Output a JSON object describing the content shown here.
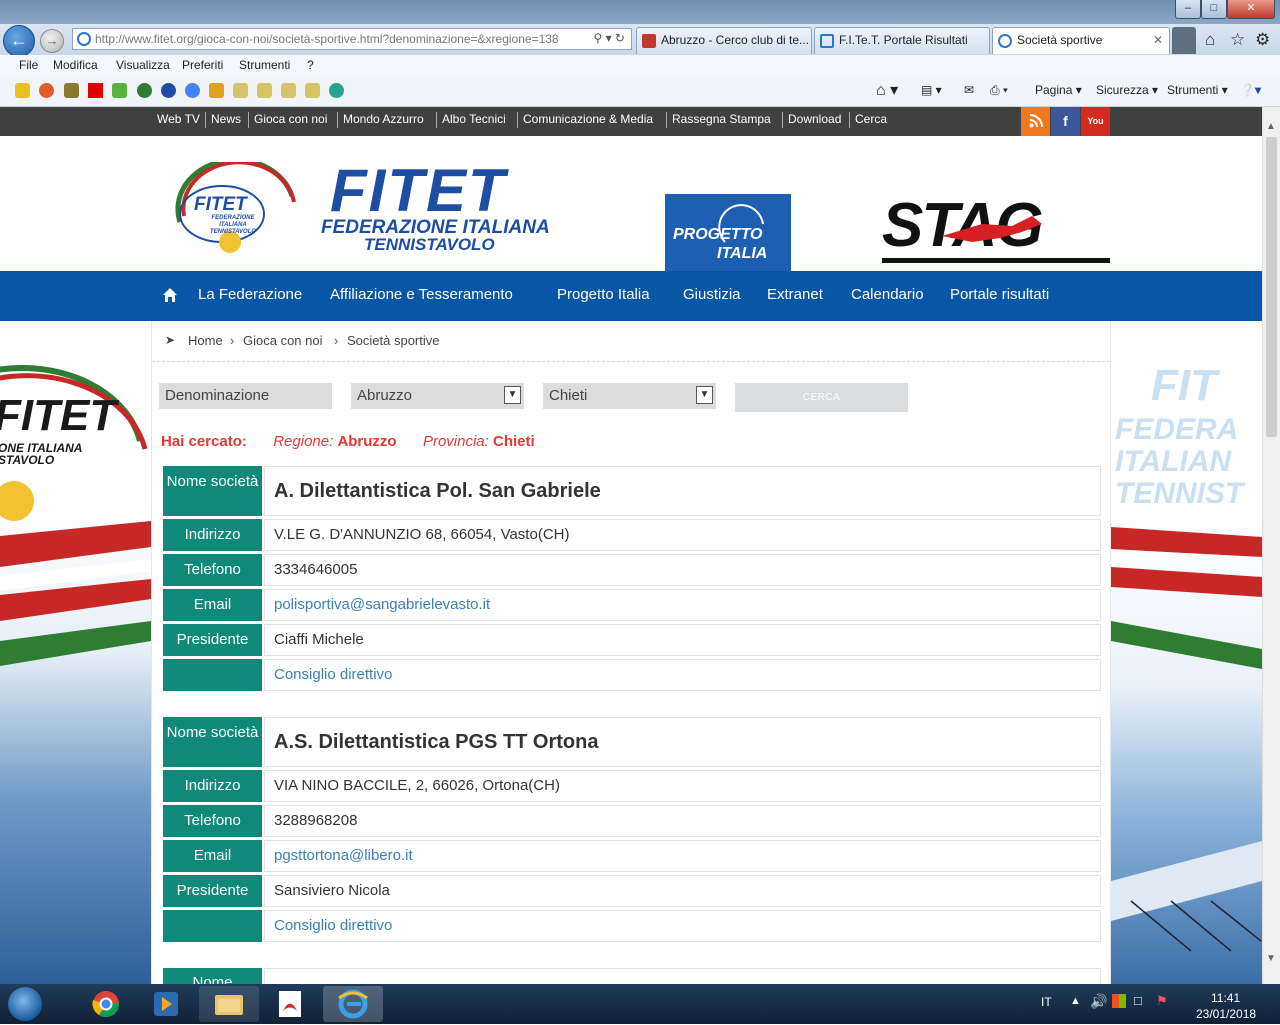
{
  "browser": {
    "url": "http://www.fitet.org/gioca-con-noi/società-sportive.html?denominazione=&xregione=138",
    "tabs": [
      {
        "label": "Abruzzo - Cerco club di te..."
      },
      {
        "label": "F.I.Te.T. Portale Risultati"
      },
      {
        "label": "Società sportive"
      }
    ],
    "menu": [
      "File",
      "Modifica",
      "Visualizza",
      "Preferiti",
      "Strumenti",
      "?"
    ],
    "toolbar": {
      "pagina": "Pagina",
      "sicurezza": "Sicurezza",
      "strumenti": "Strumenti"
    }
  },
  "site": {
    "toplinks": [
      "Web TV",
      "News",
      "Gioca con noi",
      "Mondo Azzurro",
      "Albo Tecnici",
      "Comunicazione & Media",
      "Rassegna Stampa",
      "Download",
      "Cerca"
    ],
    "social": {
      "rss": "",
      "facebook": "f",
      "youtube": "You"
    },
    "logo": {
      "round_text": "FITET",
      "round_sub": "FEDERAZIONE ITALIANA TENNISTAVOLO",
      "word": "FITET",
      "sub1": "FEDERAZIONE ITALIANA",
      "sub2": "TENNISTAVOLO"
    },
    "progetto": {
      "line1": "PROGETTO",
      "line2": "ITALIA"
    },
    "stag": "STAG",
    "mainnav": [
      "La Federazione",
      "Affiliazione e Tesseramento",
      "Progetto Italia",
      "Giustizia",
      "Extranet",
      "Calendario",
      "Portale risultati"
    ],
    "side_text": {
      "left1": "FITET",
      "left2": "ONE ITALIANA",
      "left3": "STAVOLO",
      "right1": "FIT",
      "right2": "FEDERA",
      "right3": "ITALIAN",
      "right4": "TENNIST"
    }
  },
  "breadcrumb": [
    "Home",
    "Gioca con noi",
    "Società sportive"
  ],
  "filters": {
    "denominazione": "Denominazione",
    "regione": "Abruzzo",
    "provincia": "Chieti",
    "search_label": "CERCA"
  },
  "searched": {
    "label": "Hai cercato:",
    "regione_label": "Regione:",
    "regione_value": "Abruzzo",
    "provincia_label": "Provincia:",
    "provincia_value": "Chieti"
  },
  "labels": {
    "nome": "Nome società",
    "indirizzo": "Indirizzo",
    "telefono": "Telefono",
    "email": "Email",
    "presidente": "Presidente",
    "consiglio": "Consiglio direttivo"
  },
  "clubs": [
    {
      "name": "A. Dilettantistica Pol. San Gabriele",
      "address": "V.LE G. D'ANNUNZIO 68, 66054, Vasto(CH)",
      "phone": "3334646005",
      "email": "polisportiva@sangabrielevasto.it",
      "president": "Ciaffi Michele"
    },
    {
      "name": "A.S. Dilettantistica PGS TT Ortona",
      "address": "VIA NINO BACCILE, 2, 66026, Ortona(CH)",
      "phone": "3288968208",
      "email": "pgsttortona@libero.it",
      "president": "Sansiviero Nicola"
    }
  ],
  "partial_label": "Nome",
  "taskbar": {
    "lang": "IT",
    "time": "11:41",
    "date": "23/01/2018"
  },
  "colors": {
    "nav_blue": "#0a56a6",
    "label_teal": "#0f8a7a",
    "searched_red": "#e53935",
    "link_blue": "#3a7fb9",
    "top_bar": "#404040"
  }
}
